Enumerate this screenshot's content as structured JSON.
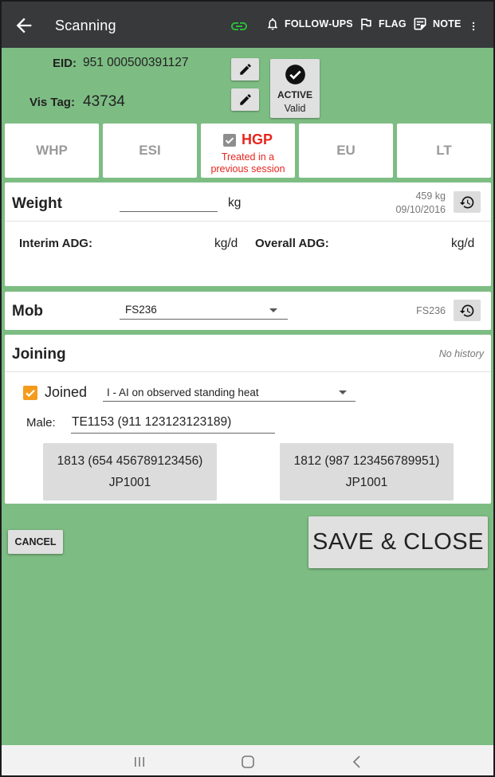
{
  "appbar": {
    "title": "Scanning",
    "actions": {
      "follow_ups": "FOLLOW-UPS",
      "flag": "FLAG",
      "note": "NOTE"
    }
  },
  "animal": {
    "eid_label": "EID:",
    "eid_value": "951 000500391127",
    "vistag_label": "Vis Tag:",
    "vistag_value": "43734",
    "status_title": "ACTIVE",
    "status_sub": "Valid"
  },
  "status_tiles": [
    {
      "label": "WHP"
    },
    {
      "label": "ESI"
    },
    {
      "label": "HGP",
      "note_line1": "Treated in a",
      "note_line2": "previous session",
      "checked": true
    },
    {
      "label": "EU"
    },
    {
      "label": "LT"
    }
  ],
  "weight": {
    "title": "Weight",
    "value": "",
    "unit": "kg",
    "last_value": "459 kg",
    "last_date": "09/10/2016",
    "interim_label": "Interim ADG:",
    "interim_unit": "kg/d",
    "overall_label": "Overall ADG:",
    "overall_unit": "kg/d"
  },
  "mob": {
    "title": "Mob",
    "selected": "FS236",
    "previous": "FS236"
  },
  "joining": {
    "title": "Joining",
    "history": "No history",
    "joined_label": "Joined",
    "joined_checked": true,
    "method": "I - AI on observed standing heat",
    "male_label": "Male:",
    "male_value": "TE1153 (911 123123123189)",
    "suggestions": [
      {
        "line1": "1813 (654 456789123456)",
        "line2": "JP1001"
      },
      {
        "line1": "1812 (987 123456789951)",
        "line2": "JP1001"
      }
    ]
  },
  "buttons": {
    "cancel": "CANCEL",
    "save_close": "SAVE & CLOSE"
  },
  "colors": {
    "background": "#7dbd83",
    "appbar": "#37393b",
    "hgp_red": "#e6261f",
    "checkbox_orange": "#f59b1c",
    "link_green": "#2ebd3c"
  }
}
